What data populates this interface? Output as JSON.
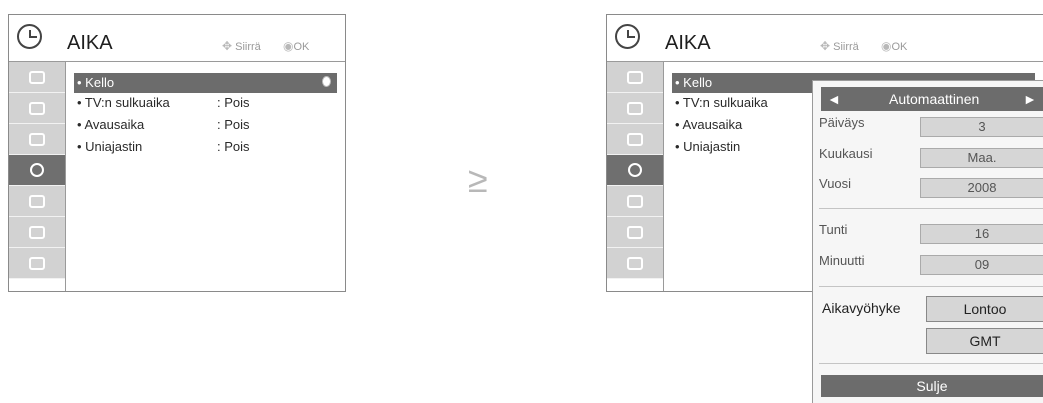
{
  "left": {
    "title": "AIKA",
    "hint_move": "Siirrä",
    "hint_ok": "OK",
    "rows": [
      {
        "label": "• Kello",
        "value": ""
      },
      {
        "label": "• TV:n sulkuaika",
        "value": ": Pois"
      },
      {
        "label": "• Avausaika",
        "value": ": Pois"
      },
      {
        "label": "• Uniajastin",
        "value": ": Pois"
      }
    ]
  },
  "right": {
    "title": "AIKA",
    "hint_move": "Siirrä",
    "hint_ok": "OK",
    "rows": [
      "• Kello",
      "• TV:n sulkuaika",
      "• Avausaika",
      "• Uniajastin"
    ]
  },
  "arrow": "≥",
  "dialog": {
    "mode": "Automaattinen",
    "left_arrow": "◄",
    "right_arrow": "►",
    "paivays_label": "Päiväys",
    "paivays": "3",
    "kuukausi_label": "Kuukausi",
    "kuukausi": "Maa.",
    "vuosi_label": "Vuosi",
    "vuosi": "2008",
    "tunti_label": "Tunti",
    "tunti": "16",
    "minuutti_label": "Minuutti",
    "minuutti": "09",
    "aikavyohyke_label": "Aikavyöhyke",
    "zone": "Lontoo",
    "gmt": "GMT",
    "close": "Sulje"
  }
}
